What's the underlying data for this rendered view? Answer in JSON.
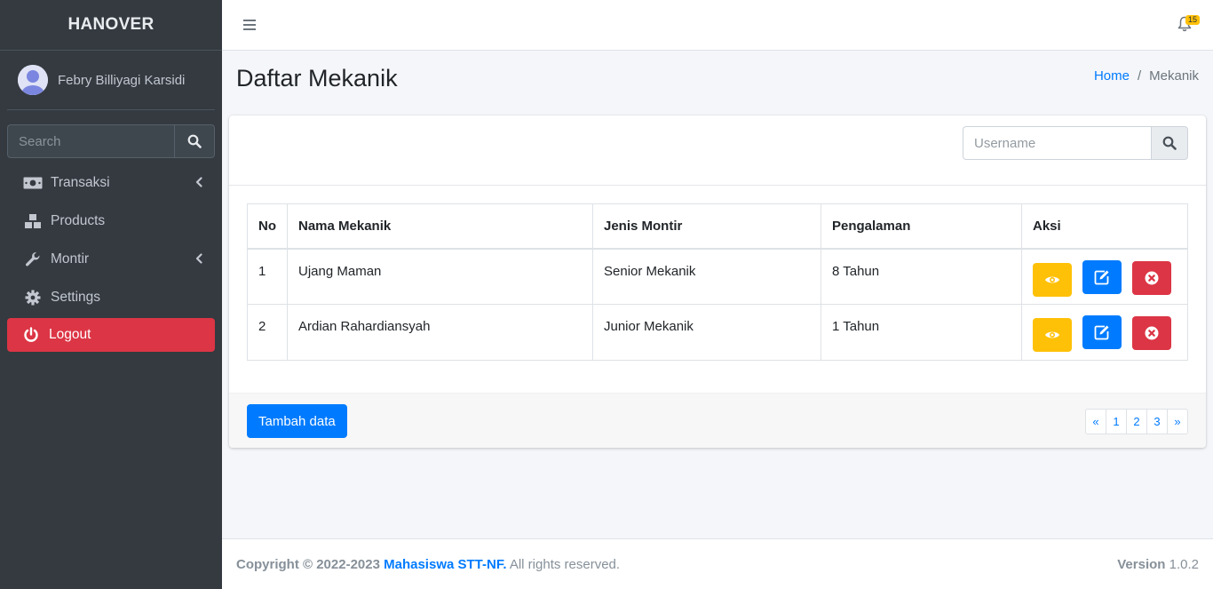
{
  "sidebar": {
    "brand": "HANOVER",
    "user_name": "Febry Billiyagi Karsidi",
    "search_placeholder": "Search",
    "items": [
      {
        "label": "Transaksi",
        "icon": "money-bill-icon",
        "has_submenu": true
      },
      {
        "label": "Products",
        "icon": "cubes-icon",
        "has_submenu": false
      },
      {
        "label": "Montir",
        "icon": "wrench-icon",
        "has_submenu": true
      },
      {
        "label": "Settings",
        "icon": "gear-icon",
        "has_submenu": false
      }
    ],
    "logout_label": "Logout"
  },
  "navbar": {
    "notification_count": "15"
  },
  "header": {
    "title": "Daftar Mekanik",
    "breadcrumb": {
      "home": "Home",
      "separator": "/",
      "current": "Mekanik"
    }
  },
  "card": {
    "search_placeholder": "Username",
    "table": {
      "columns": [
        "No",
        "Nama Mekanik",
        "Jenis Montir",
        "Pengalaman",
        "Aksi"
      ],
      "rows": [
        {
          "no": "1",
          "nama": "Ujang Maman",
          "jenis": "Senior Mekanik",
          "pengalaman": "8 Tahun"
        },
        {
          "no": "2",
          "nama": "Ardian Rahardiansyah",
          "jenis": "Junior Mekanik",
          "pengalaman": "1 Tahun"
        }
      ]
    },
    "add_button": "Tambah data",
    "pagination": [
      "«",
      "1",
      "2",
      "3",
      "»"
    ]
  },
  "footer": {
    "copyright": "Copyright © 2022-2023",
    "org": "Mahasiswa STT-NF.",
    "rights": "All rights reserved.",
    "version_label": "Version",
    "version": "1.0.2"
  },
  "colors": {
    "sidebar_bg": "#343a40",
    "primary": "#007bff",
    "danger": "#dc3545",
    "warning": "#ffc107"
  }
}
